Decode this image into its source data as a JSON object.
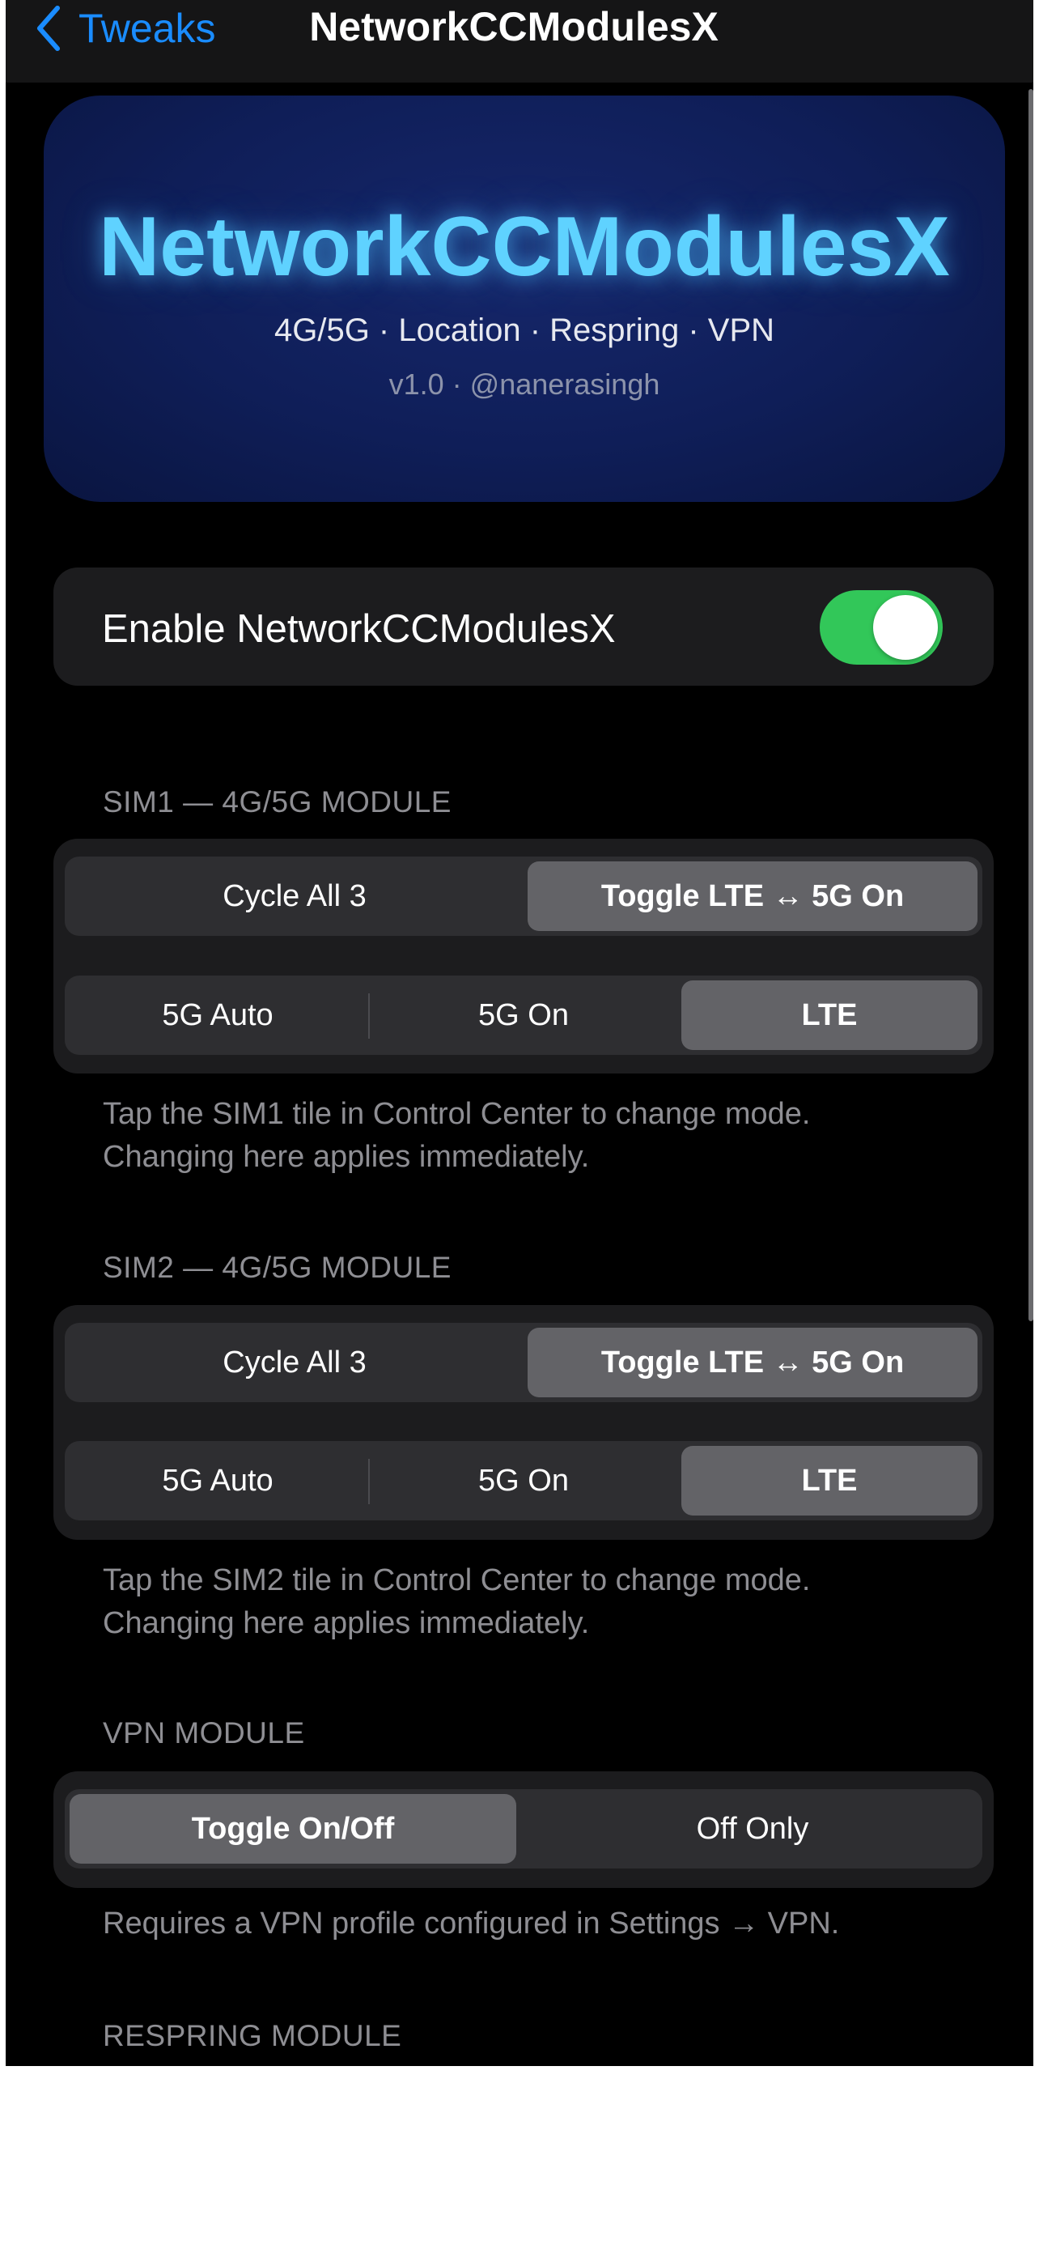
{
  "nav": {
    "back_label": "Tweaks",
    "title": "NetworkCCModulesX"
  },
  "hero": {
    "title": "NetworkCCModulesX",
    "subtitle": "4G/5G · Location · Respring · VPN",
    "meta": "v1.0  ·  @nanerasingh"
  },
  "enable": {
    "label": "Enable NetworkCCModulesX",
    "on": true,
    "color": "#32c759"
  },
  "sim1": {
    "header": "SIM1 — 4G/5G MODULE",
    "behavior_options": [
      "Cycle All 3",
      "Toggle LTE ↔ 5G On"
    ],
    "behavior_selected": "Toggle LTE ↔ 5G On",
    "mode_options": [
      "5G Auto",
      "5G On",
      "LTE"
    ],
    "mode_selected": "LTE",
    "footnote_line1": "Tap the SIM1 tile in Control Center to change mode.",
    "footnote_line2": "Changing here applies immediately."
  },
  "sim2": {
    "header": "SIM2 — 4G/5G MODULE",
    "behavior_options": [
      "Cycle All 3",
      "Toggle LTE ↔ 5G On"
    ],
    "behavior_selected": "Toggle LTE ↔ 5G On",
    "mode_options": [
      "5G Auto",
      "5G On",
      "LTE"
    ],
    "mode_selected": "LTE",
    "footnote_line1": "Tap the SIM2 tile in Control Center to change mode.",
    "footnote_line2": "Changing here applies immediately."
  },
  "vpn": {
    "header": "VPN MODULE",
    "options": [
      "Toggle On/Off",
      "Off Only"
    ],
    "selected": "Toggle On/Off",
    "footnote": "Requires a VPN profile configured in Settings → VPN."
  },
  "respring": {
    "header": "RESPRING MODULE"
  },
  "colors": {
    "accent": "#1a8cff",
    "hero_title": "#5fd2ff",
    "hero_bg": "#0f1e58",
    "card_bg": "#1c1c1e"
  }
}
